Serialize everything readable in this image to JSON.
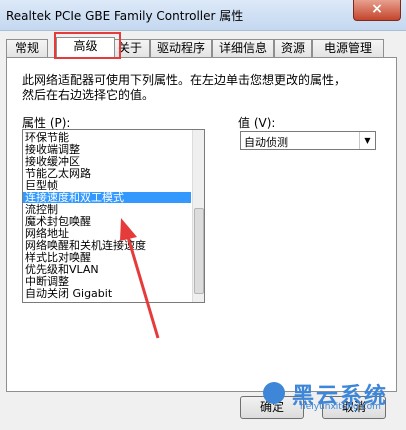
{
  "window": {
    "title": "Realtek PCIe GBE Family Controller 属性",
    "close_glyph": "×"
  },
  "tabs": [
    {
      "label": "常规"
    },
    {
      "label": "高级",
      "active": true
    },
    {
      "label": "关于"
    },
    {
      "label": "驱动程序"
    },
    {
      "label": "详细信息"
    },
    {
      "label": "资源"
    },
    {
      "label": "电源管理"
    }
  ],
  "description": {
    "line1": "此网络适配器可使用下列属性。在左边单击您想更改的属性，",
    "line2": "然后在右边选择它的值。"
  },
  "properties": {
    "label": "属性 (P):",
    "items": [
      "环保节能",
      "接收端调整",
      "接收缓冲区",
      "节能乙太网路",
      "巨型帧",
      "连接速度和双工模式",
      "流控制",
      "魔术封包唤醒",
      "网络地址",
      "网络唤醒和关机连接速度",
      "样式比对唤醒",
      "优先级和VLAN",
      "中断调整",
      "自动关闭 Gigabit"
    ],
    "selected": "连接速度和双工模式"
  },
  "value": {
    "label": "值 (V):",
    "selected": "自动侦测"
  },
  "buttons": {
    "ok": "确定",
    "cancel": "取消"
  },
  "watermark": {
    "text": "黑云系统",
    "url": "heiyunxitong.com"
  },
  "annotation_color": "#e53b3b",
  "selection_color": "#3399ff"
}
